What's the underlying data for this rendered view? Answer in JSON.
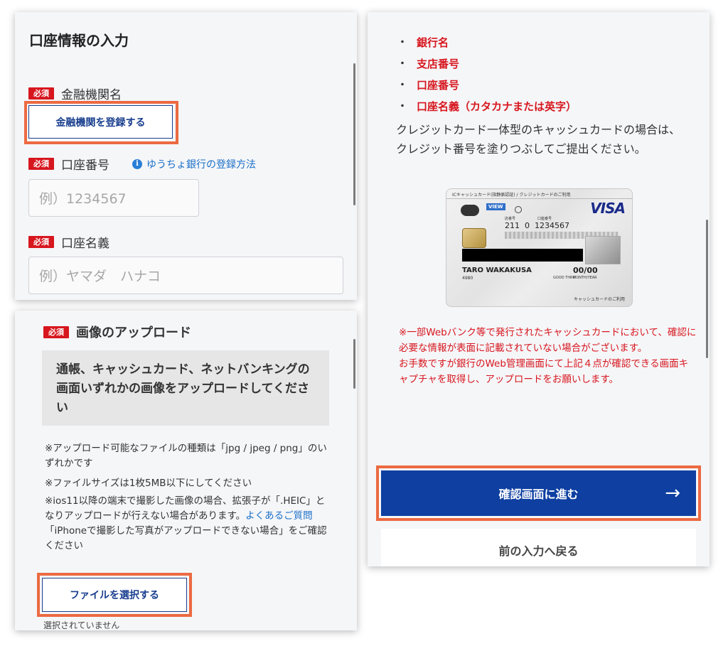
{
  "common": {
    "required_badge": "必須"
  },
  "account_panel": {
    "title": "口座情報の入力",
    "bank_name": {
      "label": "金融機関名",
      "button": "金融機関を登録する"
    },
    "account_number": {
      "label": "口座番号",
      "help_link": "ゆうちょ銀行の登録方法",
      "placeholder": "例）1234567"
    },
    "account_holder": {
      "label": "口座名義",
      "placeholder": "例）ヤマダ　ハナコ"
    }
  },
  "upload_panel": {
    "title": "画像のアップロード",
    "instruction": "通帳、キャッシュカード、ネットバンキングの画面いずれかの画像をアップロードしてください",
    "notes": {
      "file_types": "※アップロード可能なファイルの種類は「jpg / jpeg / png」のいずれかです",
      "file_size": "※ファイルサイズは1枚5MB以下にしてください",
      "ios_prefix": "※ios11以降の端末で撮影した画像の場合、拡張子が「.HEIC」となりアップロードが行えない場合があります。",
      "faq_link": "よくあるご質問",
      "ios_suffix": "「iPhoneで撮影した写真がアップロードできない場合」をご確認ください"
    },
    "select_button": "ファイルを選択する",
    "no_file": "選択されていません"
  },
  "confirm_panel": {
    "bullets": [
      "銀行名",
      "支店番号",
      "口座番号",
      "口座名義（カタカナまたは英字）"
    ],
    "bullet_mark": "・",
    "description": "クレジットカード一体型のキャッシュカードの場合は、クレジット番号を塗りつぶしてご提出ください。",
    "card": {
      "header": "ICキャッシュカード(指静脈認証) / クレジットカードのご利用",
      "brand": "VISA",
      "view": "VIEW",
      "branch_label": "店番号",
      "account_label": "口座番号",
      "branch_number": "211",
      "account_type": "0",
      "account_number": "1234567",
      "holder": "TARO WAKAKUSA",
      "code": "4980",
      "expiry": "00/00",
      "good_thru": "GOOD THRU",
      "month_year": "MONTH/YEAR",
      "footer": "キャッシュカードのご利用"
    },
    "warning": "※一部Webバンク等で発行されたキャッシュカードにおいて、確認に必要な情報が表面に記載されていない場合がございます。\nお手数ですが銀行のWeb管理画面にて上記４点が確認できる画面キャプチャを取得し、アップロードをお願いします。",
    "next_button": "確認画面に進む",
    "next_arrow": "→",
    "back_button": "前の入力へ戻る"
  },
  "colors": {
    "accent": "#d7161e",
    "primary": "#0e3fa1",
    "highlight": "#ec6a42",
    "link": "#1a6fc9"
  }
}
